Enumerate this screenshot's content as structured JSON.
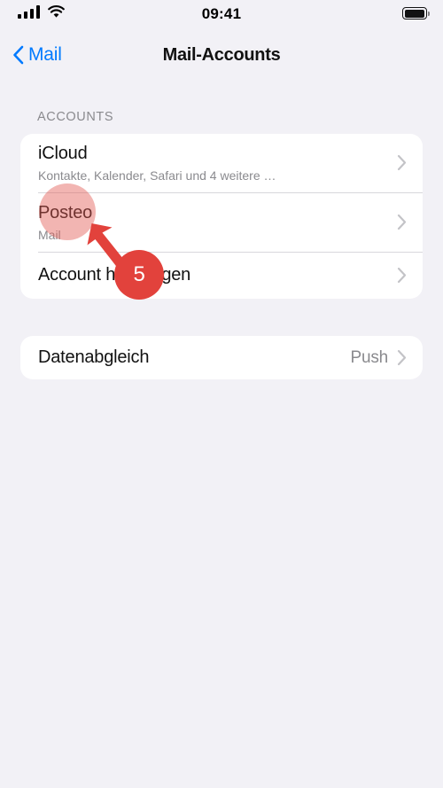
{
  "status_bar": {
    "time": "09:41",
    "signal_icon": "cellular-bars-icon",
    "wifi_icon": "wifi-icon",
    "battery_icon": "battery-icon"
  },
  "nav_bar": {
    "back_icon": "chevron-left-icon",
    "back_label": "Mail",
    "title": "Mail-Accounts"
  },
  "accounts_section": {
    "header": "ACCOUNTS",
    "rows": [
      {
        "title": "iCloud",
        "subtitle": "Kontakte, Kalender, Safari und 4 weitere …",
        "chevron_icon": "chevron-right-icon"
      },
      {
        "title": "Posteo",
        "subtitle": "Mail",
        "chevron_icon": "chevron-right-icon"
      },
      {
        "title": "Account hinzufügen",
        "chevron_icon": "chevron-right-icon"
      }
    ]
  },
  "sync_section": {
    "rows": [
      {
        "title": "Datenabgleich",
        "value": "Push",
        "chevron_icon": "chevron-right-icon"
      }
    ]
  },
  "annotation": {
    "step_number": "5",
    "highlight_color": "#e25a55",
    "badge_color": "#e2423c",
    "arrow_icon": "arrow-up-left-icon"
  },
  "colors": {
    "background": "#f2f1f6",
    "card": "#ffffff",
    "accent_blue": "#007aff",
    "secondary_text": "#8a8a8e"
  }
}
